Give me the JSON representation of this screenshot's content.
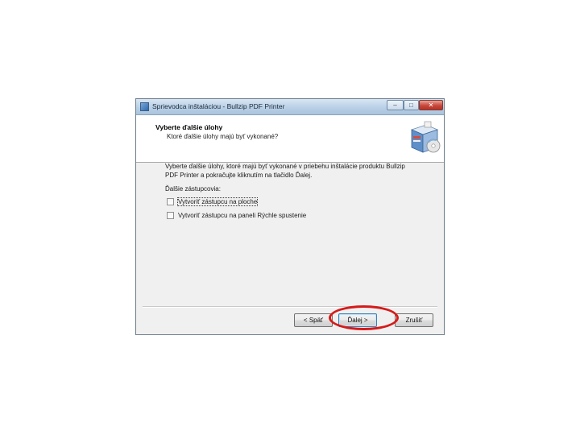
{
  "window": {
    "title": "Sprievodca inštaláciou - Bullzip PDF Printer",
    "controls": {
      "minimize": "–",
      "maximize": "□",
      "close": "✕"
    }
  },
  "header": {
    "title": "Vyberte ďalšie úlohy",
    "subtitle": "Ktoré ďalšie úlohy majú byť vykonané?",
    "icon": "install-box-icon"
  },
  "content": {
    "description": "Vyberte ďalšie úlohy, ktoré majú byť vykonané v priebehu inštalácie produktu Bullzip PDF Printer a pokračujte kliknutím na tlačidlo Ďalej.",
    "tasks_label": "Ďalšie zástupcovia:",
    "tasks": [
      {
        "label": "Vytvoriť zástupcu na ploche",
        "checked": false
      },
      {
        "label": "Vytvoriť zástupcu na paneli Rýchle spustenie",
        "checked": false
      }
    ]
  },
  "buttons": {
    "back": "< Späť",
    "next": "Ďalej >",
    "cancel": "Zrušiť"
  },
  "annotation": {
    "color": "#d61a1a",
    "target": "next-button"
  }
}
